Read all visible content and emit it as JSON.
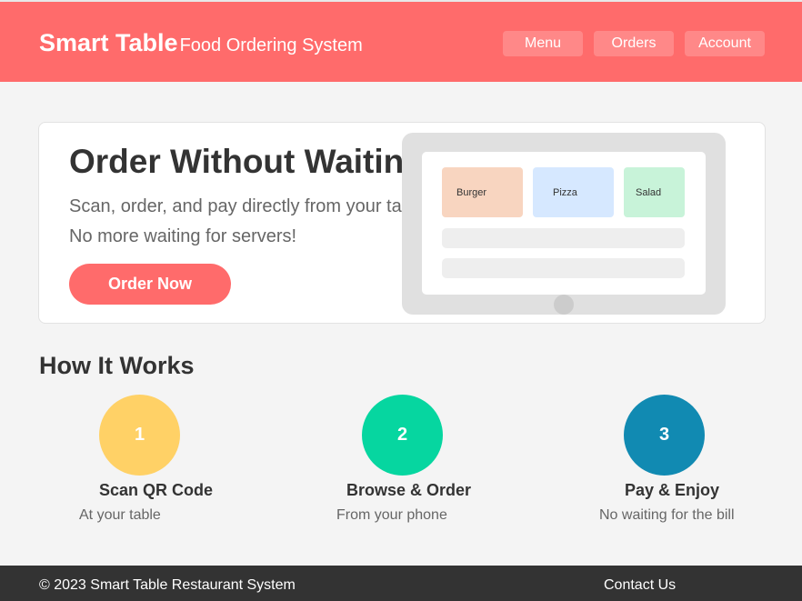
{
  "header": {
    "brand_name": "Smart Table",
    "brand_subtitle": "Food Ordering System",
    "nav": [
      "Menu",
      "Orders",
      "Account"
    ]
  },
  "hero": {
    "title": "Order Without Waiting",
    "line1": "Scan, order, and pay directly from your table",
    "line2": "No more waiting for servers!",
    "cta_label": "Order Now",
    "preview_items": [
      "Burger",
      "Pizza",
      "Salad"
    ]
  },
  "how_it_works": {
    "title": "How It Works",
    "steps": [
      {
        "number": "1",
        "title": "Scan QR Code",
        "desc": "At your table"
      },
      {
        "number": "2",
        "title": "Browse & Order",
        "desc": "From your phone"
      },
      {
        "number": "3",
        "title": "Pay & Enjoy",
        "desc": "No waiting for the bill"
      }
    ]
  },
  "footer": {
    "copyright": "© 2023 Smart Table Restaurant System",
    "contact": "Contact Us"
  },
  "colors": {
    "accent": "#ff6b6b",
    "step1": "#ffd166",
    "step2": "#06d6a0",
    "step3": "#118ab2",
    "tile_burger": "#f8d5c0",
    "tile_pizza": "#d6e8ff",
    "tile_salad": "#c8f3d9",
    "footer": "#333333"
  }
}
